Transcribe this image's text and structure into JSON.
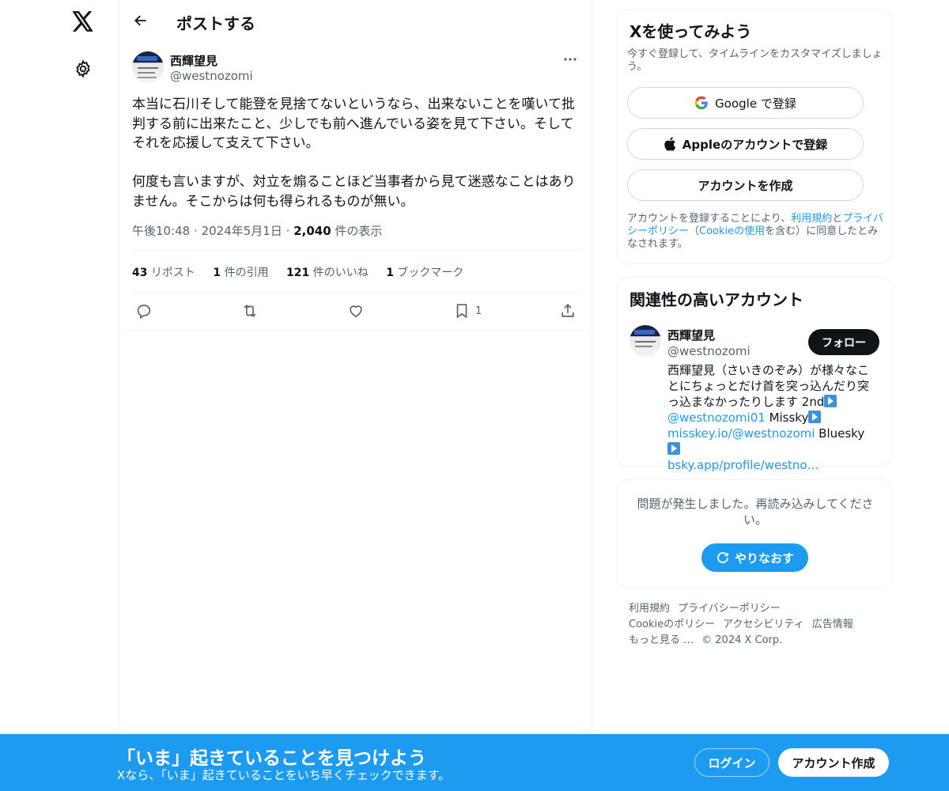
{
  "nav": {
    "logo_icon": "x-logo-icon",
    "settings_icon": "gear-icon"
  },
  "header": {
    "title": "ポストする",
    "back_icon": "arrow-left-icon"
  },
  "post": {
    "author_name": "西輝望見",
    "author_handle": "@westnozomi",
    "text": "本当に石川そして能登を見捨てないというなら、出来ないことを嘆いて批判する前に出来たこと、少しでも前へ進んでいる姿を見て下さい。そしてそれを応援して支えて下さい。\n\n何度も言いますが、対立を煽ることほど当事者から見て迷惑なことはありません。そこからは何も得られるものが無い。",
    "time": "午後10:48",
    "date": "2024年5月1日",
    "views_count": "2,040",
    "views_label": "件の表示",
    "separator": "·",
    "stats": {
      "reposts_count": "43",
      "reposts_label": "リポスト",
      "quotes_count": "1",
      "quotes_label": "件の引用",
      "likes_count": "121",
      "likes_label": "件のいいね",
      "bookmarks_count": "1",
      "bookmarks_label": "ブックマーク"
    },
    "actions": {
      "bookmark_count": "1"
    }
  },
  "signup": {
    "title": "Xを使ってみよう",
    "subtitle": "今すぐ登録して、タイムラインをカスタマイズしましょう。",
    "google_label": "Google で登録",
    "apple_label": "Appleのアカウントで登録",
    "create_label": "アカウントを作成",
    "legal_prefix": "アカウントを登録することにより、",
    "legal_terms": "利用規約",
    "legal_and": "と",
    "legal_privacy": "プライバシーポリシー",
    "legal_open": "（",
    "legal_cookie": "Cookieの使用",
    "legal_suffix": "を含む）に同意したとみなされます。"
  },
  "related": {
    "title": "関連性の高いアカウント",
    "name": "西輝望見",
    "handle": "@westnozomi",
    "follow_label": "フォロー",
    "bio_text1": "西輝望見（さいきのぞみ）が様々なことにちょっとだけ首を突っ込んだり突っ込まなかったりします 2nd",
    "bio_link1": "@westnozomi01",
    "bio_text2": " Missky",
    "bio_link2": "misskey.io/@westnozomi",
    "bio_text3": " Bluesky",
    "bio_link3": "bsky.app/profile/westno…"
  },
  "error": {
    "message": "問題が発生しました。再読み込みしてください。",
    "retry_label": "やりなおす"
  },
  "footer": {
    "links": [
      "利用規約",
      "プライバシーポリシー",
      "Cookieのポリシー",
      "アクセシビリティ",
      "広告情報",
      "もっと見る …"
    ],
    "copyright": "© 2024 X Corp."
  },
  "banner": {
    "title": "「いま」起きていることを見つけよう",
    "subtitle": "Xなら、「いま」起きていることをいち早くチェックできます。",
    "login_label": "ログイン",
    "signup_label": "アカウント作成"
  },
  "colors": {
    "accent": "#1d9bf0",
    "text": "#0f1419",
    "muted": "#536471",
    "border": "#eff3f4"
  }
}
